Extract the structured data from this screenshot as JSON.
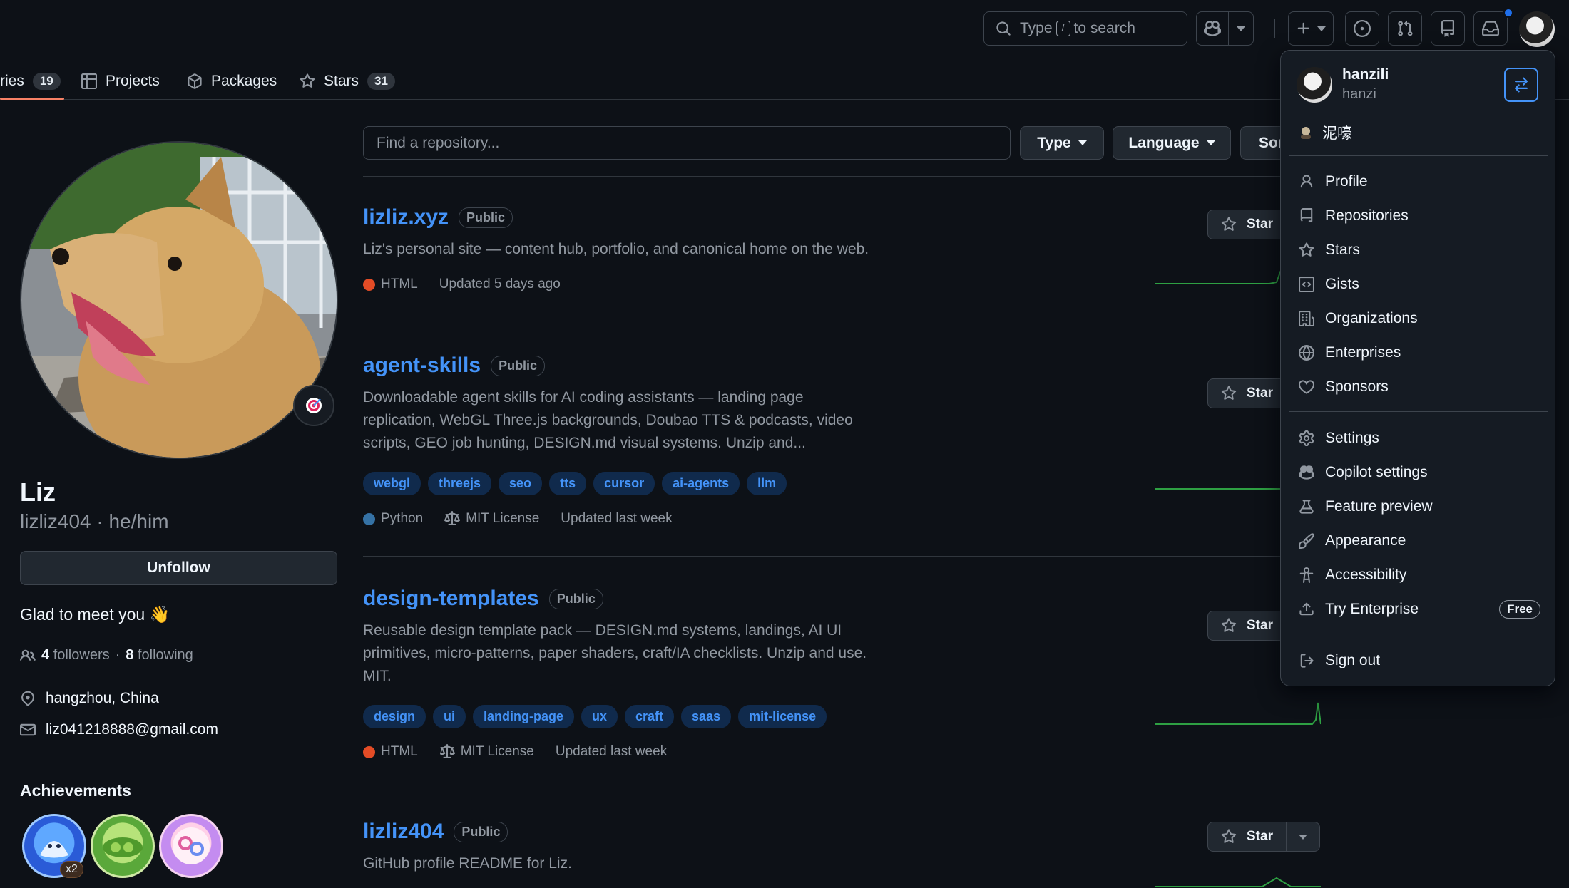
{
  "header": {
    "search_prefix": "Type",
    "search_key": "/",
    "search_suffix": "to search"
  },
  "tabs": [
    {
      "label": "ries",
      "count": "19"
    },
    {
      "label": "Projects"
    },
    {
      "label": "Packages"
    },
    {
      "label": "Stars",
      "count": "31"
    }
  ],
  "profile": {
    "name": "Liz",
    "login": "lizliz404 · he/him",
    "unfollow_label": "Unfollow",
    "bio": "Glad to meet you 👋",
    "followers_count": "4",
    "followers_label": "followers",
    "sep": "·",
    "following_count": "8",
    "following_label": "following",
    "location": "hangzhou, China",
    "email": "liz041218888@gmail.com",
    "achievements_title": "Achievements",
    "badge_multiplier": "x2"
  },
  "repo_filter": {
    "placeholder": "Find a repository...",
    "type_label": "Type",
    "language_label": "Language",
    "sort_label": "Sort"
  },
  "repos": [
    {
      "name": "lizliz.xyz",
      "visibility": "Public",
      "description": "Liz's personal site — content hub, portfolio, and canonical home on the web.",
      "language": "HTML",
      "language_color": "#e34c26",
      "updated": "Updated 5 days ago",
      "star_label": "Star"
    },
    {
      "name": "agent-skills",
      "visibility": "Public",
      "description": "Downloadable agent skills for AI coding assistants — landing page replication, WebGL Three.js backgrounds, Doubao TTS & podcasts, video scripts, GEO job hunting, DESIGN.md visual systems. Unzip and...",
      "topics": [
        "webgl",
        "threejs",
        "seo",
        "tts",
        "cursor",
        "ai-agents",
        "llm"
      ],
      "language": "Python",
      "language_color": "#3572A5",
      "license": "MIT License",
      "updated": "Updated last week",
      "star_label": "Star"
    },
    {
      "name": "design-templates",
      "visibility": "Public",
      "description": "Reusable design template pack — DESIGN.md systems, landings, AI UI primitives, micro-patterns, paper shaders, craft/IA checklists. Unzip and use. MIT.",
      "topics": [
        "design",
        "ui",
        "landing-page",
        "ux",
        "craft",
        "saas",
        "mit-license"
      ],
      "language": "HTML",
      "language_color": "#e34c26",
      "license": "MIT License",
      "updated": "Updated last week",
      "star_label": "Star"
    },
    {
      "name": "lizliz404",
      "visibility": "Public",
      "description": "GitHub profile README for Liz.",
      "star_label": "Star"
    }
  ],
  "menu": {
    "username": "hanzili",
    "login": "hanzi",
    "status": "泥嚎",
    "items_group1": [
      "Profile",
      "Repositories",
      "Stars",
      "Gists",
      "Organizations",
      "Enterprises",
      "Sponsors"
    ],
    "items_group2": [
      "Settings",
      "Copilot settings",
      "Feature preview",
      "Appearance",
      "Accessibility",
      "Try Enterprise"
    ],
    "free_tag": "Free",
    "sign_out": "Sign out"
  },
  "colors": {
    "accent_link": "#4493f8",
    "tab_underline": "#f78166",
    "sparkline": "#2ea043"
  }
}
